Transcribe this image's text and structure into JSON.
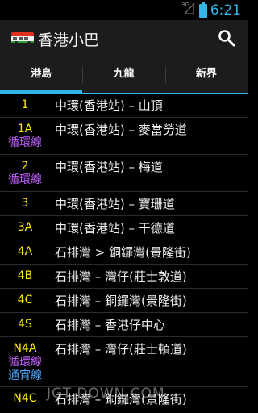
{
  "status_bar": {
    "network": "3G",
    "time": "6:21"
  },
  "app": {
    "title": "香港小巴"
  },
  "tabs": [
    {
      "label": "港島",
      "active": true
    },
    {
      "label": "九龍",
      "active": false
    },
    {
      "label": "新界",
      "active": false
    }
  ],
  "routes": [
    {
      "code": "1",
      "tags": [],
      "route": "中環(香港站) – 山頂"
    },
    {
      "code": "1A",
      "tags": [
        {
          "text": "循環線",
          "color": "#c060ff"
        }
      ],
      "route": "中環(香港站) – 麥當勞道"
    },
    {
      "code": "2",
      "tags": [
        {
          "text": "循環線",
          "color": "#c060ff"
        }
      ],
      "route": "中環(香港站) – 梅道"
    },
    {
      "code": "3",
      "tags": [],
      "route": "中環(香港站) – 寶珊道"
    },
    {
      "code": "3A",
      "tags": [],
      "route": "中環(香港站) – 干德道"
    },
    {
      "code": "4A",
      "tags": [],
      "route": "石排灣 > 銅鑼灣(景隆街)"
    },
    {
      "code": "4B",
      "tags": [],
      "route": "石排灣 – 灣仔(莊士敦道)"
    },
    {
      "code": "4C",
      "tags": [],
      "route": "石排灣 – 銅鑼灣(景隆街)"
    },
    {
      "code": "4S",
      "tags": [],
      "route": "石排灣 – 香港仔中心"
    },
    {
      "code": "N4A",
      "tags": [
        {
          "text": "循環線",
          "color": "#c060ff"
        },
        {
          "text": "通宵線",
          "color": "#4aa8ff"
        }
      ],
      "route": "石排灣 – 灣仔(莊士頓道)"
    },
    {
      "code": "N4C",
      "tags": [],
      "route": "石排灣 – 銅鑼灣(景隆街)"
    }
  ],
  "watermark": "JGT  DOWN.COM",
  "colors": {
    "accent": "#33b5e5",
    "route_code": "#ffeb00"
  },
  "icons": {
    "app": "minibus-icon",
    "search": "search-icon"
  }
}
